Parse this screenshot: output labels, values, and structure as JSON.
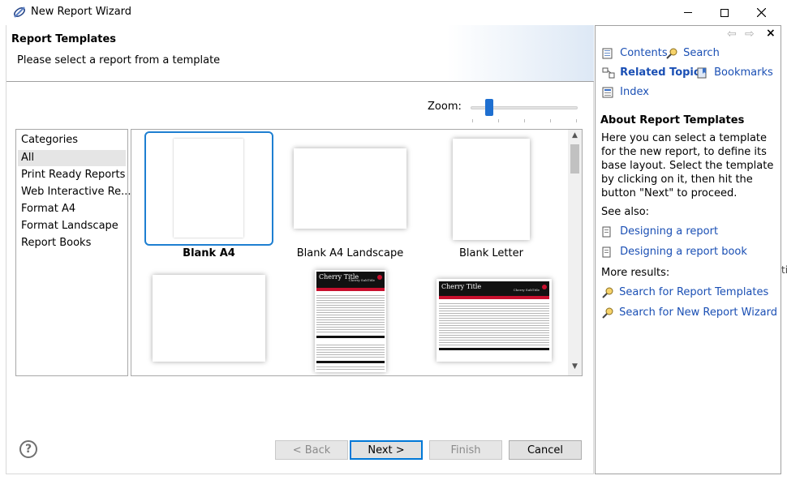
{
  "window": {
    "title": "New Report Wizard",
    "controls": {
      "minimize": "—",
      "maximize": "☐",
      "close": "✕"
    },
    "icon": "eclipse-wand-icon"
  },
  "wizard": {
    "title": "Report Templates",
    "subtitle": "Please select a report from a template",
    "zoom_label": "Zoom:",
    "zoom_level": 0.15,
    "categories": {
      "header": "Categories",
      "items": [
        "All",
        "Print Ready Reports",
        "Web Interactive Re...",
        "Format A4",
        "Format Landscape",
        "Report Books"
      ],
      "selected": "All"
    },
    "templates": [
      {
        "name": "Blank A4",
        "selected": true
      },
      {
        "name": "Blank A4 Landscape",
        "selected": false
      },
      {
        "name": "Blank Letter",
        "selected": false
      },
      {
        "name": "",
        "selected": false
      },
      {
        "name": "",
        "selected": false,
        "thumb_title": "Cherry Title",
        "thumb_subtitle": "Cherry SubTitle"
      },
      {
        "name": "",
        "selected": false,
        "thumb_title": "Cherry Title",
        "thumb_subtitle": "Cherry SubTitle"
      }
    ],
    "buttons": {
      "back": "< Back",
      "next": "Next >",
      "finish": "Finish",
      "cancel": "Cancel"
    },
    "help_symbol": "?"
  },
  "help_pane": {
    "nav": {
      "contents": "Contents",
      "search": "Search",
      "related": "Related Topics",
      "bookmarks": "Bookmarks",
      "index": "Index"
    },
    "about_title": "About Report Templates",
    "about_text": "Here you can select a template for the new report, to define its base layout. Select the template by clicking on it, then hit the button \"Next\" to proceed.",
    "see_also_label": "See also:",
    "see_also": [
      "Designing a report",
      "Designing a report book"
    ],
    "more_results_label": "More results:",
    "more_results": [
      "Search for Report Templates",
      "Search for New Report Wizard"
    ],
    "close_symbol": "×"
  },
  "edge_stub": "ti"
}
